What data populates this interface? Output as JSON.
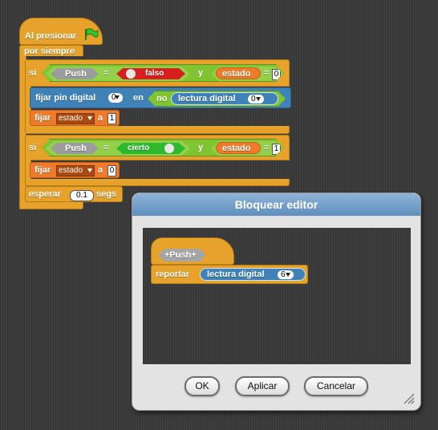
{
  "script": {
    "hat_label": "Al presionar",
    "forever_label": "por siempre",
    "if1": {
      "si": "si",
      "var": "Push",
      "eq": "=",
      "bool_value": "falso",
      "and": "y",
      "var2": "estado",
      "eq2": "=",
      "num": "0"
    },
    "set_pin": {
      "label": "fijar pin digital",
      "pin": "0",
      "en": "en",
      "no": "no",
      "read_label": "lectura digital",
      "read_pin": "0"
    },
    "set1": {
      "fijar": "fijar",
      "var": "estado",
      "a": "a",
      "value": "1"
    },
    "if2": {
      "si": "si",
      "var": "Push",
      "eq": "=",
      "bool_value": "cierto",
      "and": "y",
      "var2": "estado",
      "eq2": "=",
      "num": "1"
    },
    "set2": {
      "fijar": "fijar",
      "var": "estado",
      "a": "a",
      "value": "0"
    },
    "wait": {
      "label": "esperar",
      "value": "0.1",
      "unit": "segs"
    }
  },
  "dialog": {
    "title": "Bloquear editor",
    "hat_param": "+Push+",
    "report_label": "reportar",
    "read_label": "lectura digital",
    "read_pin": "6",
    "buttons": {
      "ok": "OK",
      "apply": "Aplicar",
      "cancel": "Cancelar"
    }
  },
  "colors": {
    "control": "#e6a22a",
    "operators": "#80c431",
    "variables": "#ef7b2a",
    "pins": "#3f82b8",
    "title_bar": "#5e8fbd"
  }
}
